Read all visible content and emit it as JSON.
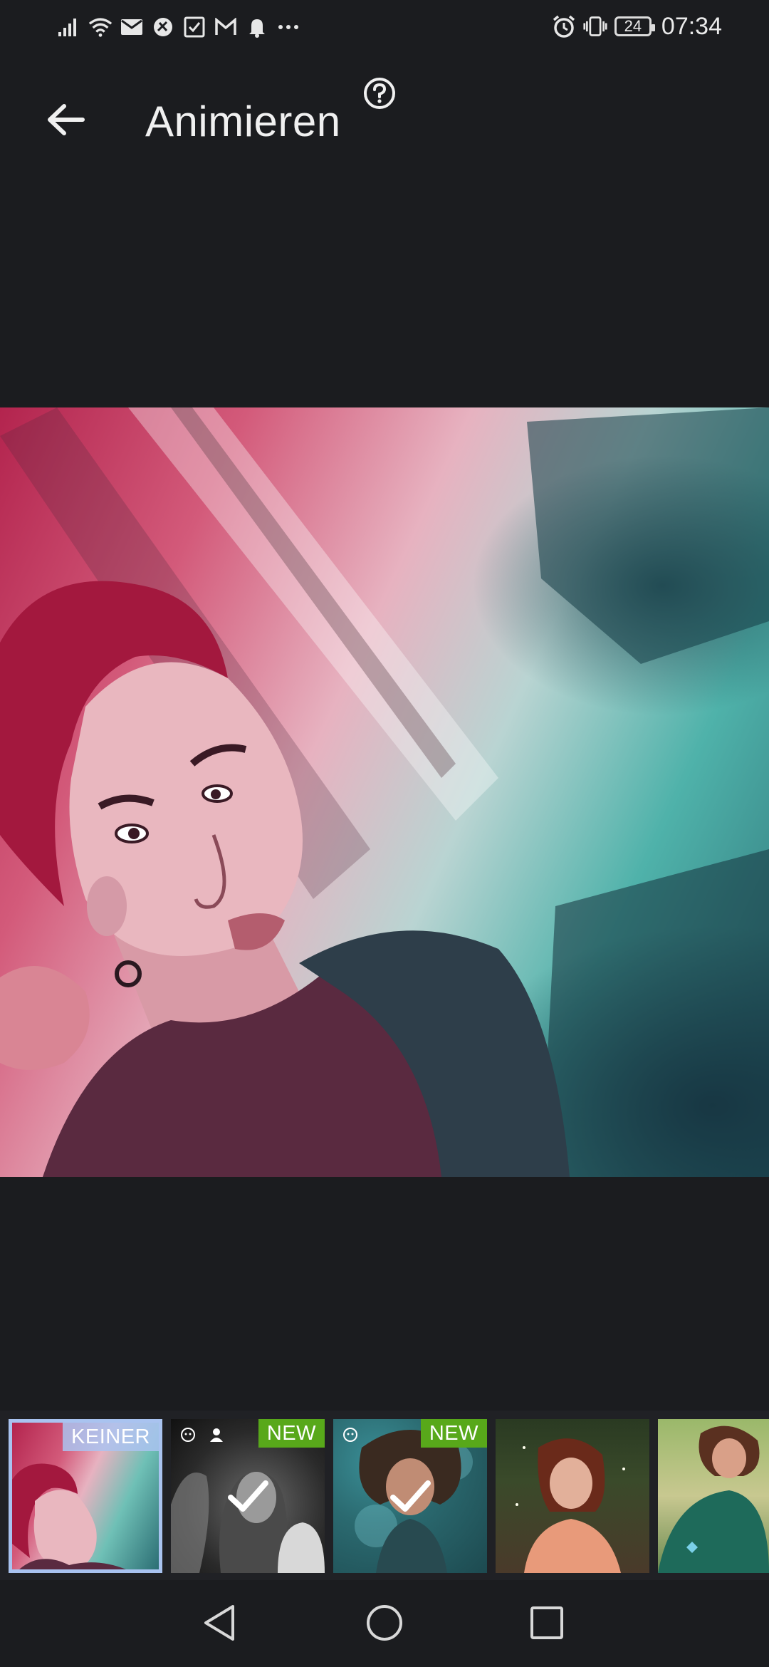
{
  "status_bar": {
    "time": "07:34",
    "battery": "24",
    "left_icons": [
      "signal-icon",
      "wifi-icon",
      "mail-icon",
      "vpn-icon",
      "task-icon",
      "gmail-icon",
      "bell-icon",
      "more-icon"
    ],
    "right_icons": [
      "alarm-icon",
      "vibrate-icon",
      "battery-icon"
    ]
  },
  "header": {
    "title": "Animieren",
    "back_icon": "arrow-left-icon",
    "help_icon": "help-circle-icon"
  },
  "thumbnails": [
    {
      "badge": "KEINER",
      "selected": true
    },
    {
      "badge": "NEW",
      "selected": false,
      "checked": true
    },
    {
      "badge": "NEW",
      "selected": false,
      "checked": true
    },
    {
      "badge": "",
      "selected": false
    },
    {
      "badge": "",
      "selected": false
    }
  ],
  "colors": {
    "background": "#1b1c1f",
    "selected_border": "#a9c3f0",
    "new_badge": "#58a81a"
  },
  "navigation": [
    "back-triangle-icon",
    "home-circle-icon",
    "recents-square-icon"
  ]
}
